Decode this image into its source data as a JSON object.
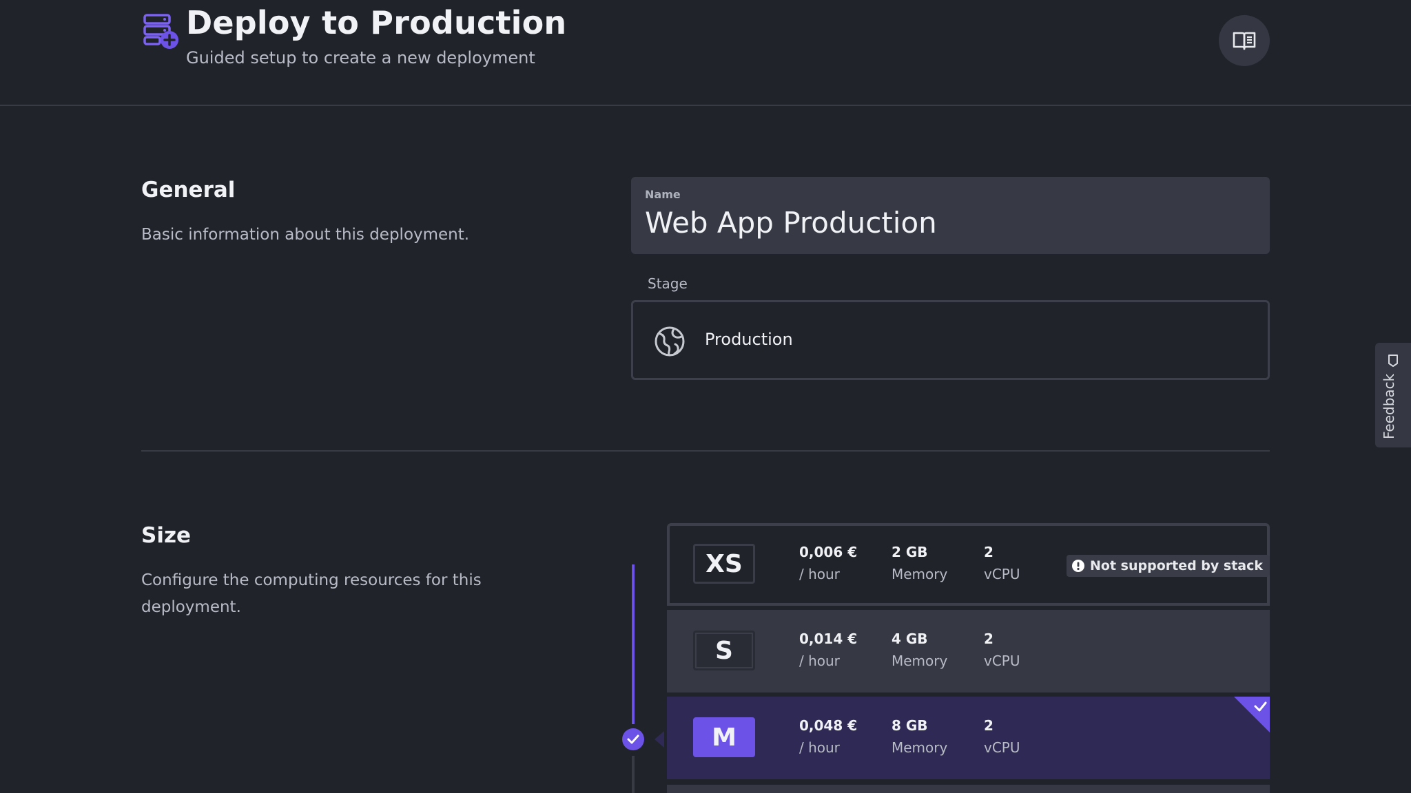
{
  "header": {
    "title": "Deploy to Production",
    "subtitle": "Guided setup to create a new deployment",
    "icon": "server-add-icon",
    "docs_button_icon": "book-icon"
  },
  "general": {
    "title": "General",
    "description": "Basic information about this deployment.",
    "name_field": {
      "label": "Name",
      "value": "Web App Production"
    },
    "stage": {
      "label": "Stage",
      "value": "Production",
      "icon": "globe-icon"
    }
  },
  "size": {
    "title": "Size",
    "description": "Configure the computing resources for this deployment.",
    "selected": "M",
    "options": [
      {
        "name": "XS",
        "price": "0,006 €",
        "price_unit": "/ hour",
        "memory": "2 GB",
        "memory_label": "Memory",
        "cpu": "2",
        "cpu_label": "vCPU",
        "warning": "Not supported by stack"
      },
      {
        "name": "S",
        "price": "0,014 €",
        "price_unit": "/ hour",
        "memory": "4 GB",
        "memory_label": "Memory",
        "cpu": "2",
        "cpu_label": "vCPU"
      },
      {
        "name": "M",
        "price": "0,048 €",
        "price_unit": "/ hour",
        "memory": "8 GB",
        "memory_label": "Memory",
        "cpu": "2",
        "cpu_label": "vCPU"
      }
    ]
  },
  "feedback": {
    "label": "Feedback"
  },
  "colors": {
    "background": "#21232b",
    "accent": "#6c52e6",
    "selected_row": "#2e2a55",
    "field": "#373a45"
  }
}
